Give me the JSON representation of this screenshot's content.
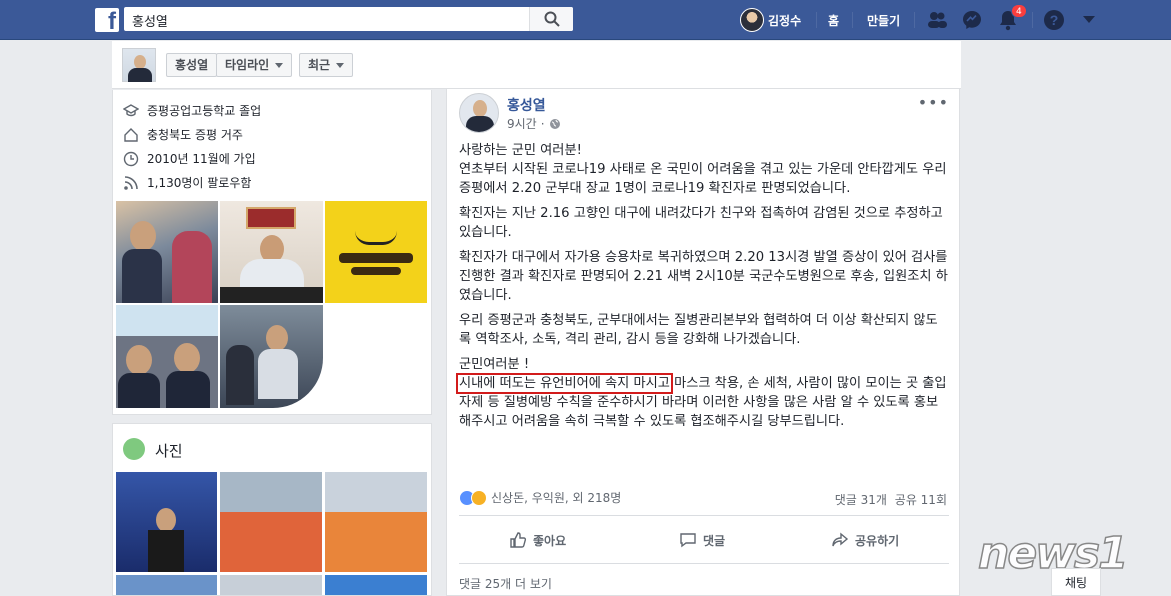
{
  "topbar": {
    "logo": "f",
    "search_value": "홍성열",
    "user_name": "김정수",
    "home_label": "홈",
    "create_label": "만들기",
    "notification_count": "4"
  },
  "profile_header": {
    "name_tab": "홍성열",
    "timeline_tab": "타임라인",
    "recent_tab": "최근"
  },
  "intro": [
    {
      "icon": "education-icon",
      "text": "증평공업고등학교 졸업"
    },
    {
      "icon": "home-icon",
      "text": "충청북도 증평 거주"
    },
    {
      "icon": "clock-icon",
      "text": "2010년 11월에 가입"
    },
    {
      "icon": "rss-icon",
      "text": "1,130명이 팔로우함"
    }
  ],
  "photos_section": {
    "title": "사진"
  },
  "post": {
    "author": "홍성열",
    "time": "9시간",
    "privacy_icon": "globe-icon",
    "paragraphs": [
      [
        "사랑하는 군민 여러분!",
        "연초부터 시작된 코로나19 사태로 온 국민이 어려움을 겪고 있는 가운데 안타깝게도 우리 증평에서 2.20 군부대 장교 1명이 코로나19 확진자로 판명되었습니다."
      ],
      [
        "확진자는 지난 2.16 고향인 대구에 내려갔다가 친구와 접촉하여 감염된 것으로 추정하고 있습니다."
      ],
      [
        "확진자가 대구에서 자가용 승용차로 복귀하였으며 2.20 13시경 발열 증상이 있어 검사를 진행한 결과 확진자로 판명되어 2.21 새벽 2시10분 국군수도병원으로 후송, 입원조치 하였습니다."
      ],
      [
        "우리 증평군과 충청북도, 군부대에서는 질병관리본부와 협력하여 더 이상 확산되지 않도록 역학조사, 소독, 격리 관리, 감시 등을 강화해 나가겠습니다."
      ]
    ],
    "closing_greeting": "군민여러분 !",
    "highlighted_text": "시내에 떠도는 유언비어에 속지 마시고",
    "closing_rest": "마스크 착용, 손 세척, 사람이 많이 모이는 곳 출입 자제 등 질병예방 수칙을 준수하시기 바라며 이러한 사항을 많은 사람 알 수 있도록 홍보해주시고 어려움을 속히 극복할 수 있도록 협조해주시길 당부드립니다.",
    "reactions_text": "신상돈, 우익원, 외 218명",
    "comments_count": "댓글 31개",
    "shares_count": "공유 11회",
    "like_label": "좋아요",
    "comment_label": "댓글",
    "share_label": "공유하기",
    "view_more": "댓글 25개 더 보기"
  },
  "chat_label": "채팅",
  "watermark": "news1",
  "colors": {
    "brand": "#3b5998",
    "highlight_box": "#d21b1b",
    "link": "#365899"
  }
}
